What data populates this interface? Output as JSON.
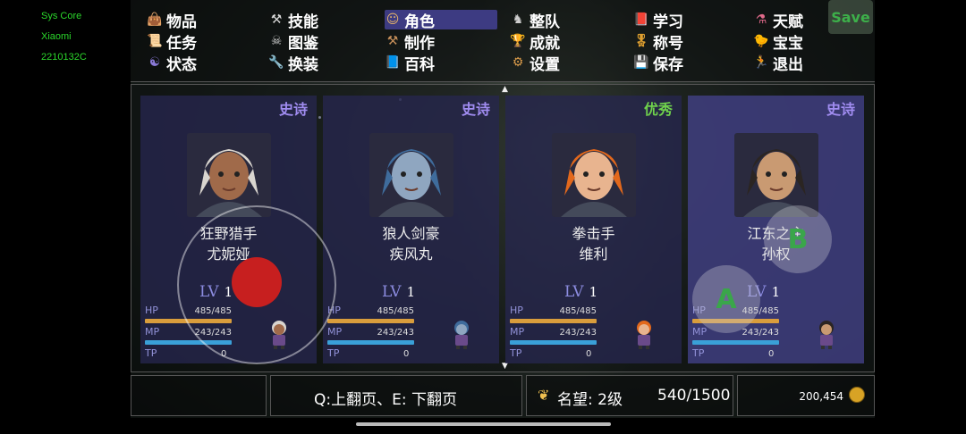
{
  "system_overlay": {
    "line1": "Sys Core",
    "line2": "Xiaomi",
    "line3": "2210132C"
  },
  "menu": {
    "items": [
      {
        "label": "物品",
        "icon": "bag-icon"
      },
      {
        "label": "技能",
        "icon": "axe-icon"
      },
      {
        "label": "角色",
        "icon": "mask-icon",
        "selected": true
      },
      {
        "label": "整队",
        "icon": "knight-icon"
      },
      {
        "label": "学习",
        "icon": "book-icon"
      },
      {
        "label": "天赋",
        "icon": "potion-icon"
      },
      {
        "label": "任务",
        "icon": "scroll-icon"
      },
      {
        "label": "图鉴",
        "icon": "skull-icon"
      },
      {
        "label": "制作",
        "icon": "hammer-icon"
      },
      {
        "label": "成就",
        "icon": "trophy-icon"
      },
      {
        "label": "称号",
        "icon": "medal-icon"
      },
      {
        "label": "宝宝",
        "icon": "pet-icon"
      },
      {
        "label": "状态",
        "icon": "status-icon"
      },
      {
        "label": "换装",
        "icon": "wrench-icon"
      },
      {
        "label": "百科",
        "icon": "encyclopedia-icon"
      },
      {
        "label": "设置",
        "icon": "gear-icon"
      },
      {
        "label": "保存",
        "icon": "floppy-icon"
      },
      {
        "label": "退出",
        "icon": "exit-icon"
      }
    ],
    "save_label": "Save"
  },
  "characters": [
    {
      "rarity": "史诗",
      "rarity_color": "#a08cf0",
      "title": "狂野猎手",
      "name": "尤妮娅",
      "lv_label": "LV",
      "level": "1",
      "hp_label": "HP",
      "hp": "485/485",
      "mp_label": "MP",
      "mp": "243/243",
      "tp_label": "TP",
      "tp": "0",
      "hair": "#d9d5cf",
      "skin": "#a06a4a"
    },
    {
      "rarity": "史诗",
      "rarity_color": "#a08cf0",
      "title": "狼人剑豪",
      "name": "疾风丸",
      "lv_label": "LV",
      "level": "1",
      "hp_label": "HP",
      "hp": "485/485",
      "mp_label": "MP",
      "mp": "243/243",
      "tp_label": "TP",
      "tp": "0",
      "hair": "#3f6c9c",
      "skin": "#8fa6c0"
    },
    {
      "rarity": "优秀",
      "rarity_color": "#6fd14c",
      "title": "拳击手",
      "name": "维利",
      "lv_label": "LV",
      "level": "1",
      "hp_label": "HP",
      "hp": "485/485",
      "mp_label": "MP",
      "mp": "243/243",
      "tp_label": "TP",
      "tp": "0",
      "hair": "#e2681c",
      "skin": "#e8b48f"
    },
    {
      "rarity": "史诗",
      "rarity_color": "#a08cf0",
      "title": "江东之主",
      "name": "孙权",
      "lv_label": "LV",
      "level": "1",
      "hp_label": "HP",
      "hp": "485/485",
      "mp_label": "MP",
      "mp": "243/243",
      "tp_label": "TP",
      "tp": "0",
      "hair": "#2b2522",
      "skin": "#c99a72"
    }
  ],
  "bottom": {
    "page_hint": "Q:上翻页、E: 下翻页",
    "reputation": "名望: 2级",
    "progress": "540/1500",
    "gold": "200,454"
  },
  "controls": {
    "button_a": "A",
    "button_b": "B"
  },
  "colors": {
    "hp_bar": "#d99d3c",
    "mp_bar": "#3aa0d8",
    "selected_menu": "#3d3b82"
  }
}
